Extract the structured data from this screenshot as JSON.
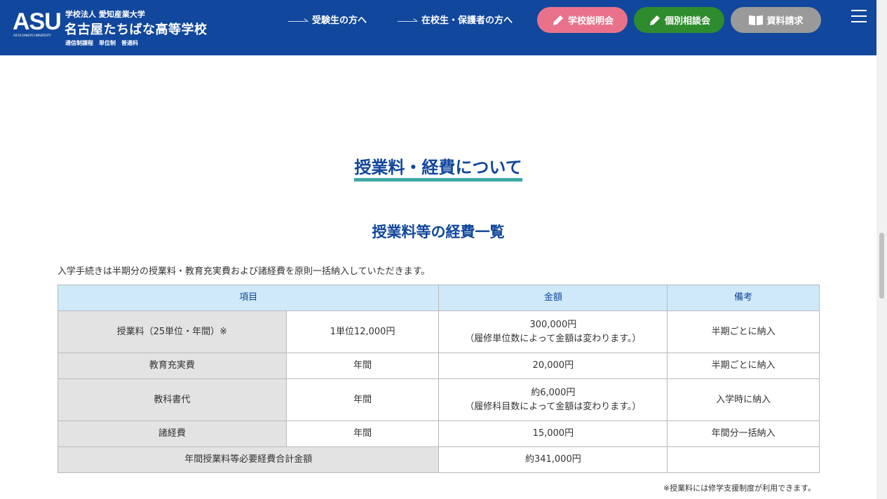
{
  "header": {
    "logo_text": "ASU",
    "logo_sub": "AICHI SANGYO UNIVERSITY",
    "school_corp": "学校法人 愛知産業大学",
    "school_name": "名古屋たちばな高等学校",
    "school_course": "通信制課程　単位制　普通科",
    "nav": [
      {
        "label": "受験生の方へ"
      },
      {
        "label": "在校生・保護者の方へ"
      }
    ],
    "buttons": {
      "info_session": "学校説明会",
      "consultation": "個別相談会",
      "brochure": "資料請求"
    },
    "colors": {
      "header_bg": "#11479c",
      "pink": "#e9728a",
      "green": "#2e8b2e",
      "gray": "#9a9a9a"
    }
  },
  "content": {
    "section_title": "授業料・経費について",
    "sub_title": "授業料等の経費一覧",
    "intro": "入学手続きは半期分の授業料・教育充実費および諸経費を原則一括納入していただきます。",
    "table": {
      "headers": {
        "item": "項目",
        "amount": "金額",
        "remarks": "備考"
      },
      "rows": [
        {
          "item": "授業料（25単位・年間）※",
          "unit": "1単位12,000円",
          "amount": "300,000円",
          "amount_note": "（履修単位数によって金額は変わります。）",
          "remarks": "半期ごとに納入"
        },
        {
          "item": "教育充実費",
          "unit": "年間",
          "amount": "20,000円",
          "amount_note": "",
          "remarks": "半期ごとに納入"
        },
        {
          "item": "教科書代",
          "unit": "年間",
          "amount": "約6,000円",
          "amount_note": "（履修科目数によって金額は変わります。）",
          "remarks": "入学時に納入"
        },
        {
          "item": "諸経費",
          "unit": "年間",
          "amount": "15,000円",
          "amount_note": "",
          "remarks": "年間分一括納入"
        }
      ],
      "total": {
        "label": "年間授業料等必要経費合計金額",
        "amount": "約341,000円",
        "remarks": ""
      }
    },
    "note": "※授業料には修学支援制度が利用できます。"
  }
}
